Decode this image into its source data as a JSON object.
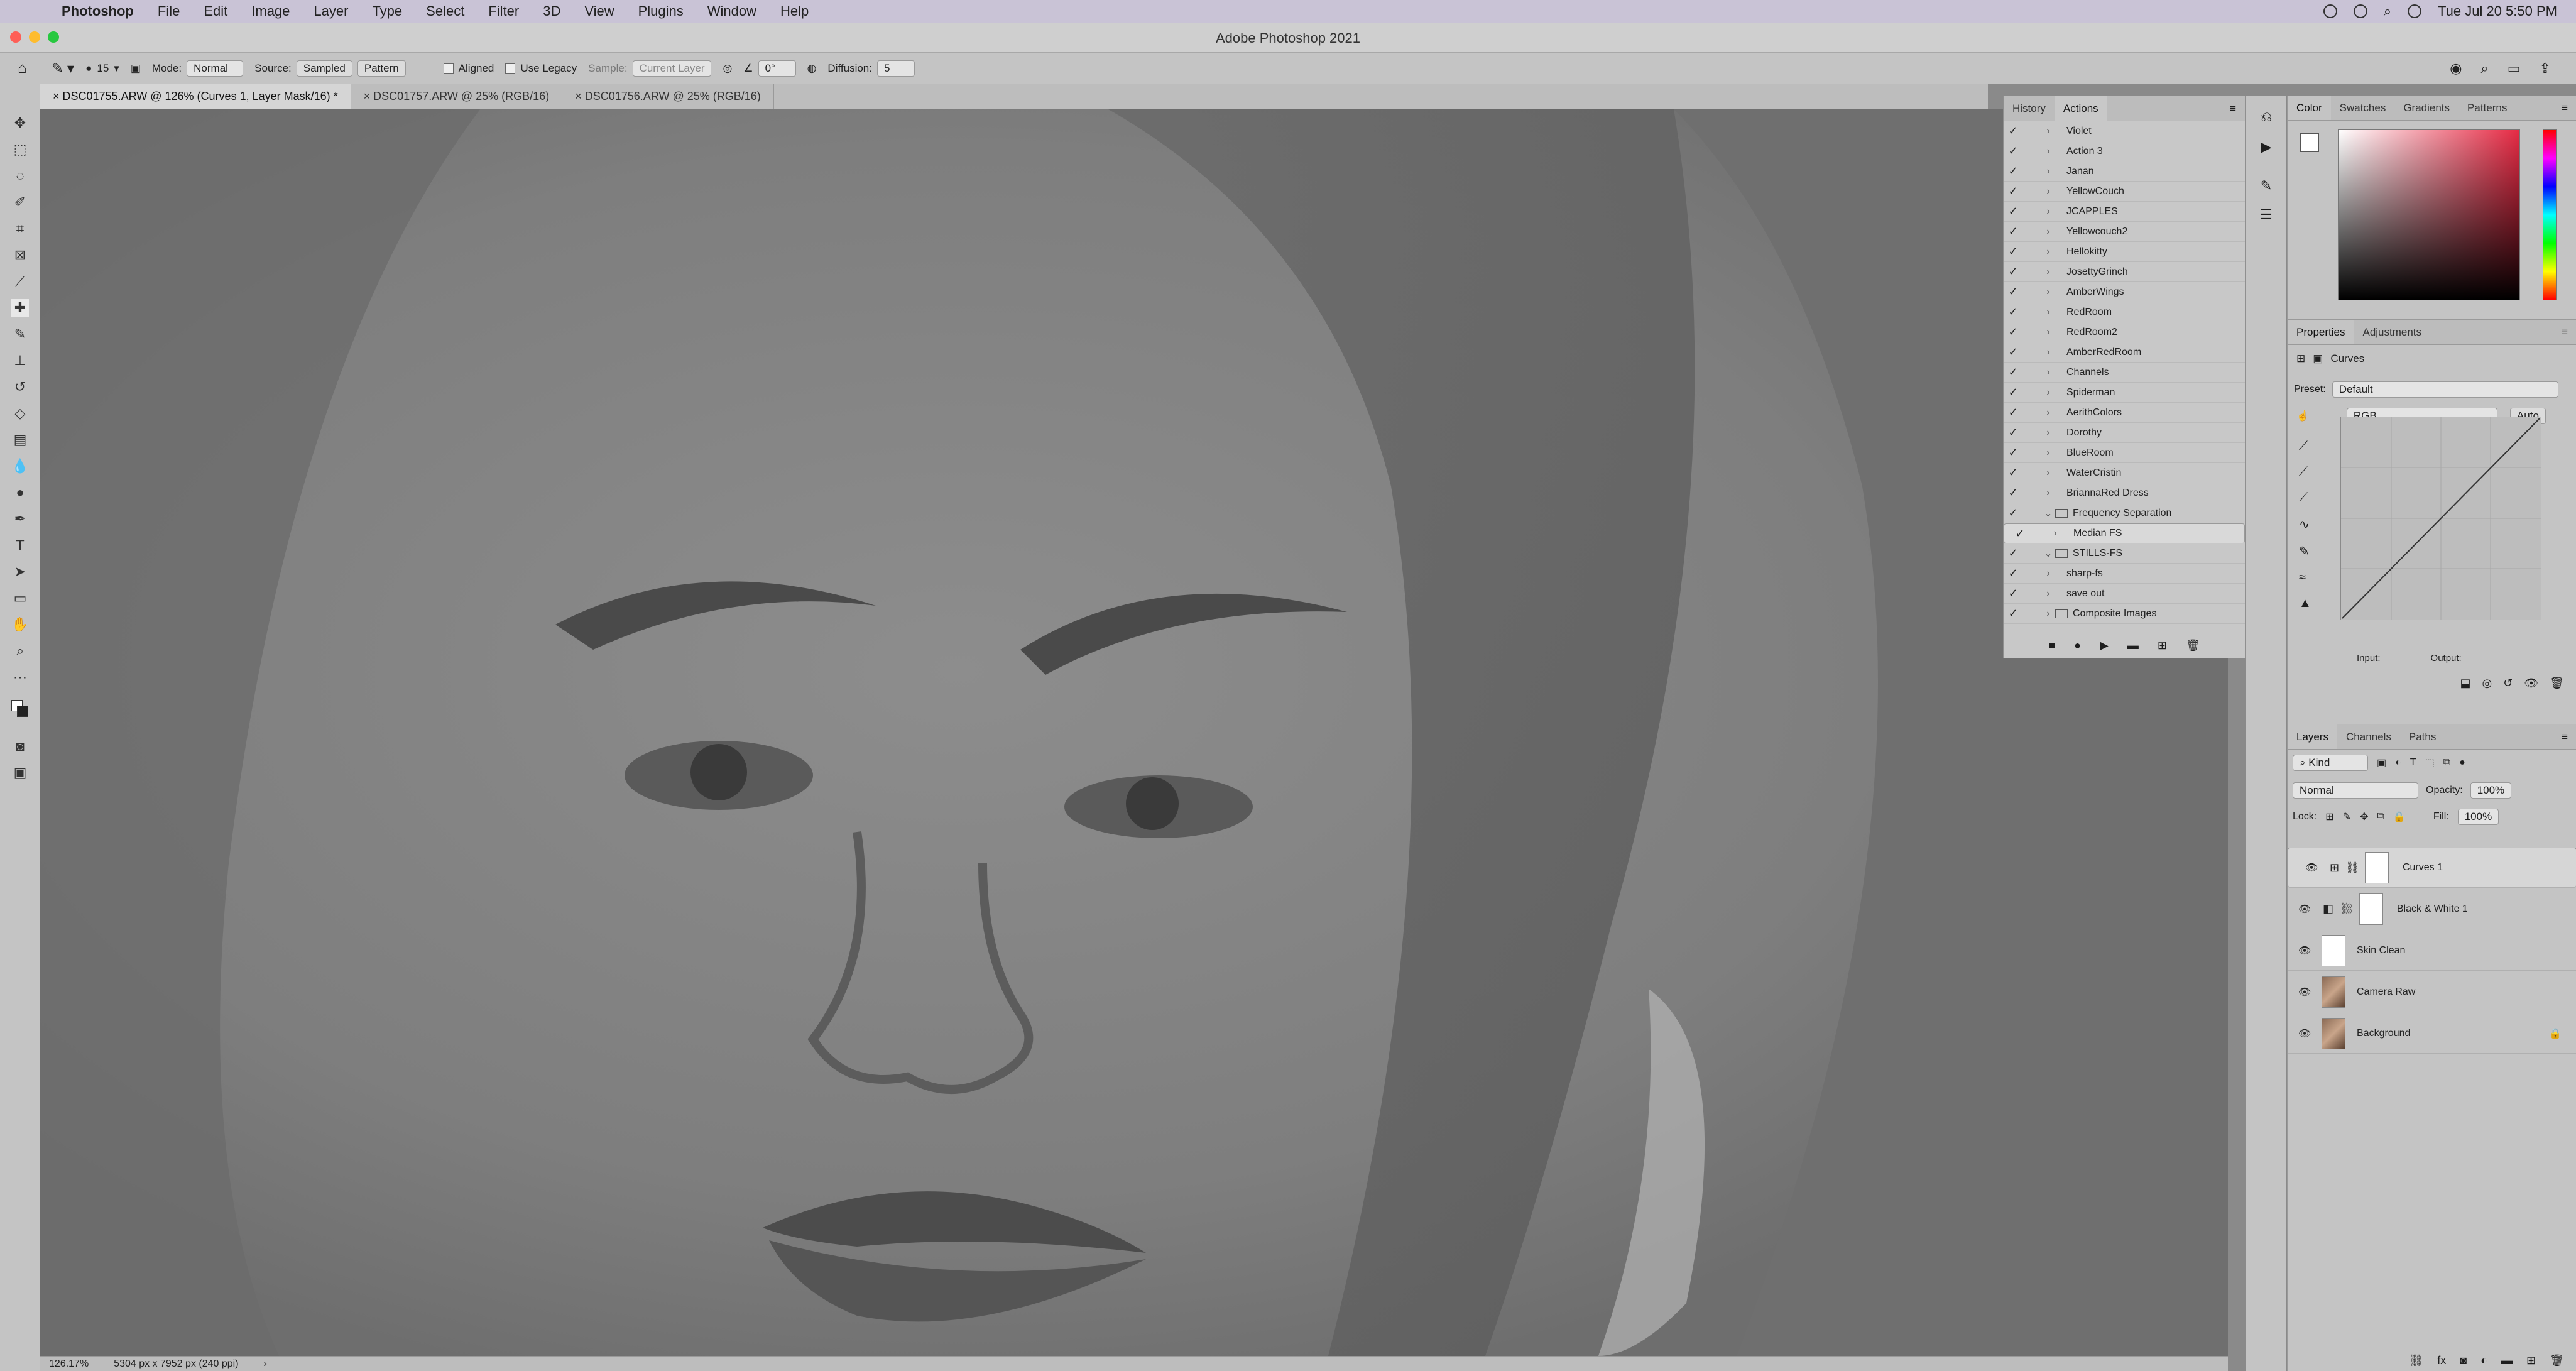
{
  "menubar": {
    "app": "Photoshop",
    "items": [
      "File",
      "Edit",
      "Image",
      "Layer",
      "Type",
      "Select",
      "Filter",
      "3D",
      "View",
      "Plugins",
      "Window",
      "Help"
    ],
    "clock": "Tue Jul 20  5:50 PM"
  },
  "window": {
    "title": "Adobe Photoshop 2021"
  },
  "options": {
    "brush_size": "15",
    "mode_label": "Mode:",
    "mode_value": "Normal",
    "source_label": "Source:",
    "source_sampled": "Sampled",
    "source_pattern": "Pattern",
    "aligned": "Aligned",
    "use_legacy": "Use Legacy",
    "sample_label": "Sample:",
    "sample_value": "Current Layer",
    "angle_value": "0°",
    "diffusion_label": "Diffusion:",
    "diffusion_value": "5"
  },
  "tabs": [
    {
      "label": "DSC01755.ARW @ 126% (Curves 1, Layer Mask/16) *"
    },
    {
      "label": "DSC01757.ARW @ 25% (RGB/16)"
    },
    {
      "label": "DSC01756.ARW @ 25% (RGB/16)"
    }
  ],
  "status": {
    "zoom": "126.17%",
    "doc": "5304 px x 7952 px (240 ppi)"
  },
  "actions_panel": {
    "tab_history": "History",
    "tab_actions": "Actions",
    "rows": [
      {
        "label": "Violet",
        "type": "action"
      },
      {
        "label": "Action 3",
        "type": "action"
      },
      {
        "label": "Janan",
        "type": "action"
      },
      {
        "label": "YellowCouch",
        "type": "action"
      },
      {
        "label": "JCAPPLES",
        "type": "action"
      },
      {
        "label": "Yellowcouch2",
        "type": "action"
      },
      {
        "label": "Hellokitty",
        "type": "action"
      },
      {
        "label": "JosettyGrinch",
        "type": "action"
      },
      {
        "label": "AmberWings",
        "type": "action"
      },
      {
        "label": "RedRoom",
        "type": "action"
      },
      {
        "label": "RedRoom2",
        "type": "action"
      },
      {
        "label": "AmberRedRoom",
        "type": "action"
      },
      {
        "label": "Channels",
        "type": "action"
      },
      {
        "label": "Spiderman",
        "type": "action"
      },
      {
        "label": "AerithColors",
        "type": "action"
      },
      {
        "label": "Dorothy",
        "type": "action"
      },
      {
        "label": "BlueRoom",
        "type": "action"
      },
      {
        "label": "WaterCristin",
        "type": "action"
      },
      {
        "label": "BriannaRed Dress",
        "type": "action"
      },
      {
        "label": "Frequency Separation",
        "type": "set-open"
      },
      {
        "label": "Median FS",
        "type": "action-selected"
      },
      {
        "label": "STILLS-FS",
        "type": "set-open"
      },
      {
        "label": "sharp-fs",
        "type": "action"
      },
      {
        "label": "save out",
        "type": "action"
      },
      {
        "label": "Composite Images",
        "type": "set"
      }
    ]
  },
  "color_panel": {
    "tabs": [
      "Color",
      "Swatches",
      "Gradients",
      "Patterns"
    ]
  },
  "properties": {
    "tabs": [
      "Properties",
      "Adjustments"
    ],
    "title": "Curves",
    "preset_label": "Preset:",
    "preset_value": "Default",
    "channel_value": "RGB",
    "auto_label": "Auto",
    "input_label": "Input:",
    "output_label": "Output:"
  },
  "layers_panel": {
    "tabs": [
      "Layers",
      "Channels",
      "Paths"
    ],
    "kind_label": "Kind",
    "blend_mode": "Normal",
    "opacity_label": "Opacity:",
    "opacity_value": "100%",
    "lock_label": "Lock:",
    "fill_label": "Fill:",
    "fill_value": "100%",
    "layers": [
      {
        "name": "Curves 1"
      },
      {
        "name": "Black & White 1"
      },
      {
        "name": "Skin Clean"
      },
      {
        "name": "Camera Raw"
      },
      {
        "name": "Background"
      }
    ]
  },
  "colors": {
    "menubar_bg": "#c9c3d6",
    "panel_bg": "#c4c4c4",
    "canvas_bg": "#7a7a7a",
    "traffic_red": "#fe5f57",
    "traffic_yellow": "#febc2e",
    "traffic_green": "#28c840"
  }
}
